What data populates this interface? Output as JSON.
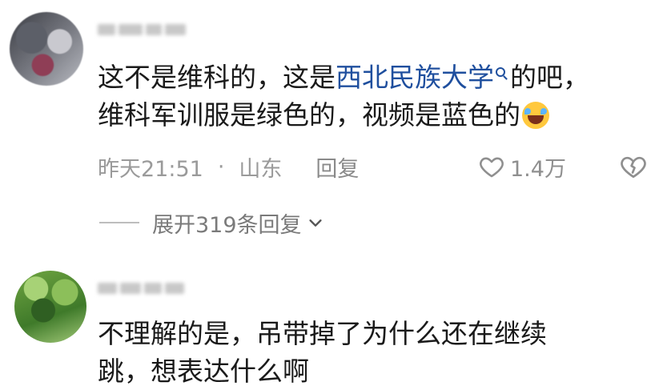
{
  "comments": [
    {
      "text_plain_1": "这不是维科的，这是",
      "link": "西北民族大学",
      "text_plain_2": "的吧，",
      "line2": "维科军训服是绿色的，视频是蓝色的",
      "time": "昨天21:51",
      "dot": "·",
      "location": "山东",
      "reply_label": "回复",
      "likes": "1.4万",
      "expand_label": "展开319条回复"
    },
    {
      "line1": "不理解的是，吊带掉了为什么还在继续",
      "line2": "跳，想表达什么啊"
    }
  ],
  "icons": {
    "like": "heart-icon",
    "dislike": "broken-heart-icon",
    "expand": "chevron-down-icon",
    "search": "search-icon",
    "emoji": "laughing-crying-emoji"
  },
  "colors": {
    "link": "#1f4f9e",
    "meta": "#9a9a9a",
    "text": "#1a1a1a"
  }
}
